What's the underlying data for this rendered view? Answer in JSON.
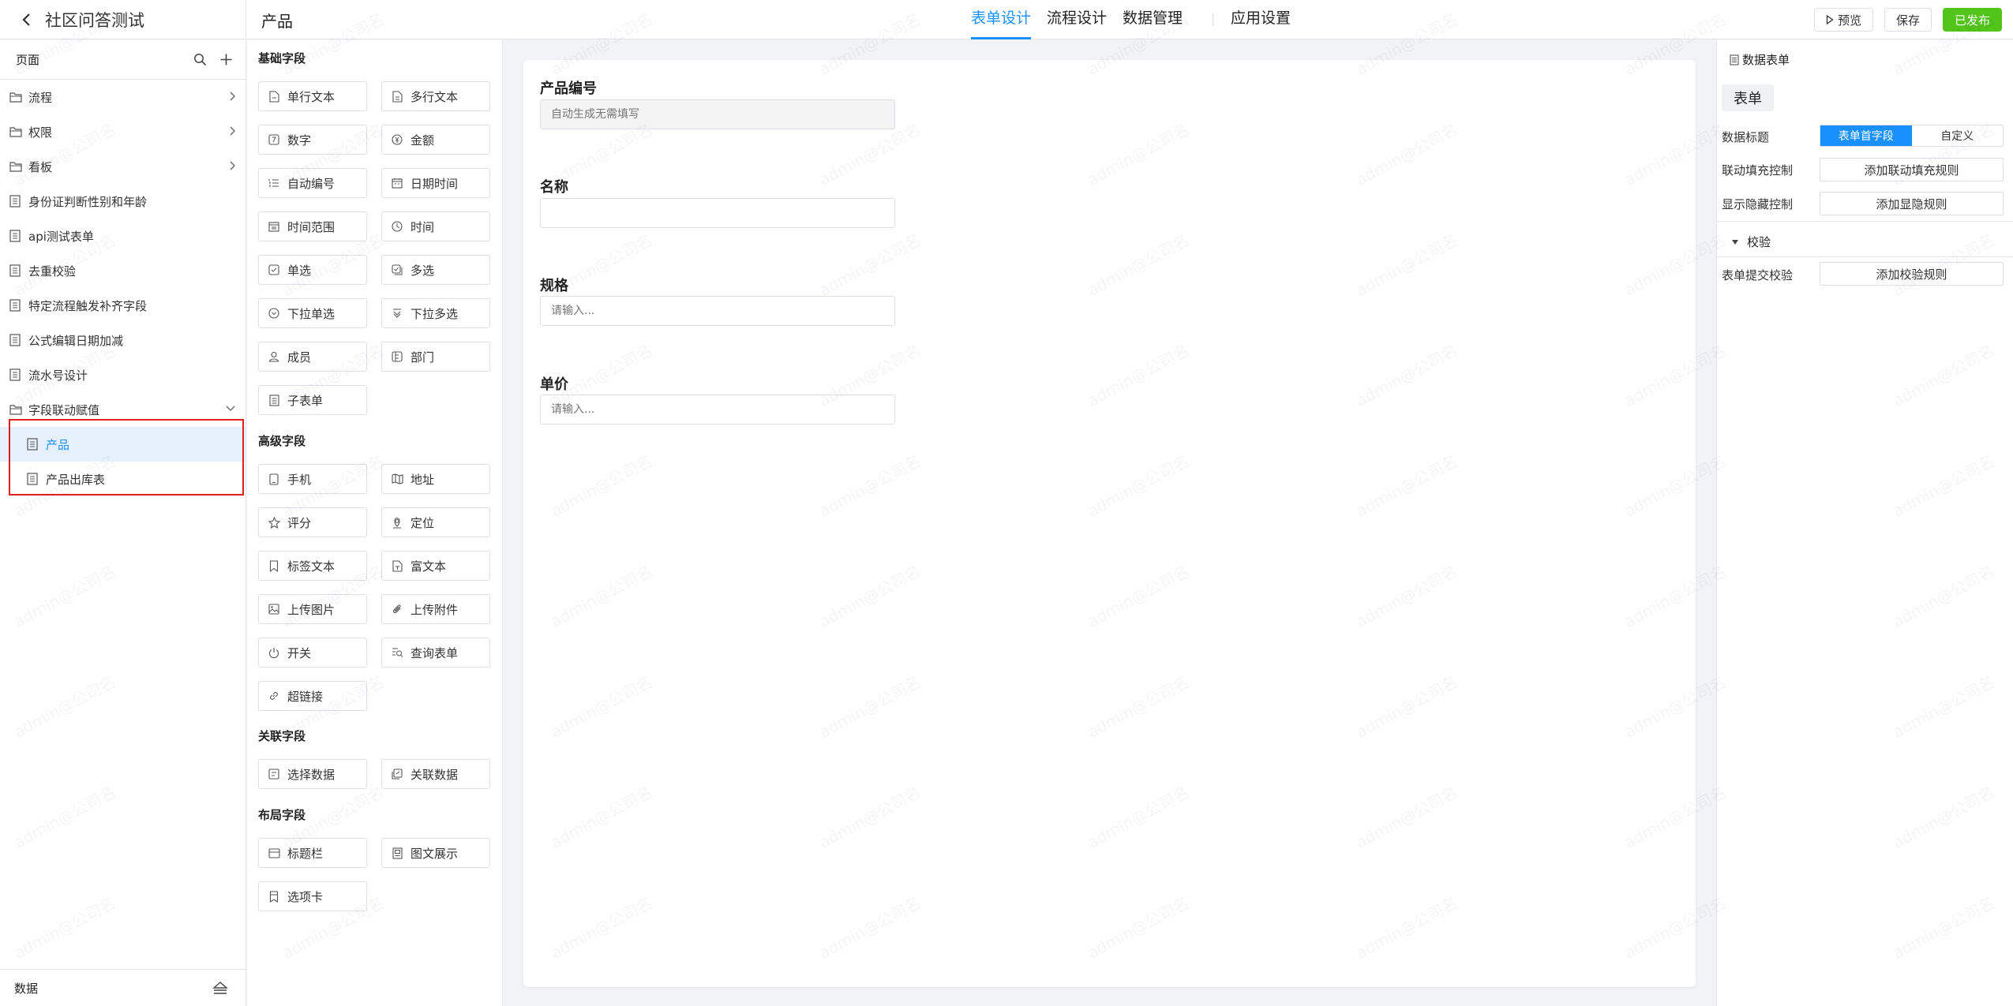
{
  "header": {
    "app_title": "社区问答测试",
    "page_title": "产品",
    "tabs": [
      {
        "label": "表单设计",
        "active": true
      },
      {
        "label": "流程设计",
        "active": false
      },
      {
        "label": "数据管理",
        "active": false
      },
      {
        "label": "应用设置",
        "active": false
      }
    ],
    "actions": {
      "preview": "预览",
      "save": "保存",
      "publish": "已发布"
    }
  },
  "sidebar": {
    "header_label": "页面",
    "items": [
      {
        "label": "流程",
        "type": "folder"
      },
      {
        "label": "权限",
        "type": "folder"
      },
      {
        "label": "看板",
        "type": "folder"
      },
      {
        "label": "身份证判断性别和年龄",
        "type": "form"
      },
      {
        "label": "api测试表单",
        "type": "form"
      },
      {
        "label": "去重校验",
        "type": "form"
      },
      {
        "label": "特定流程触发补齐字段",
        "type": "form"
      },
      {
        "label": "公式编辑日期加减",
        "type": "form"
      },
      {
        "label": "流水号设计",
        "type": "form"
      },
      {
        "label": "字段联动赋值",
        "type": "folder-open"
      },
      {
        "label": "产品",
        "type": "form",
        "selected": true
      },
      {
        "label": "产品出库表",
        "type": "form"
      }
    ],
    "footer_label": "数据"
  },
  "palette": {
    "sections": {
      "basic": "基础字段",
      "advanced": "高级字段",
      "relation": "关联字段",
      "layout": "布局字段"
    },
    "basic": [
      "单行文本",
      "多行文本",
      "数字",
      "金额",
      "自动编号",
      "日期时间",
      "时间范围",
      "时间",
      "单选",
      "多选",
      "下拉单选",
      "下拉多选",
      "成员",
      "部门",
      "子表单"
    ],
    "advanced": [
      "手机",
      "地址",
      "评分",
      "定位",
      "标签文本",
      "富文本",
      "上传图片",
      "上传附件",
      "开关",
      "查询表单",
      "超链接"
    ],
    "relation": [
      "选择数据",
      "关联数据"
    ],
    "layout": [
      "标题栏",
      "图文展示",
      "选项卡"
    ]
  },
  "form": {
    "fields": [
      {
        "label": "产品编号",
        "placeholder": "自动生成无需填写",
        "disabled": true
      },
      {
        "label": "名称",
        "placeholder": "",
        "disabled": false
      },
      {
        "label": "规格",
        "placeholder": "请输入...",
        "disabled": false
      },
      {
        "label": "单价",
        "placeholder": "请输入...",
        "disabled": false
      }
    ]
  },
  "properties": {
    "header": "数据表单",
    "tab": "表单",
    "data_title_label": "数据标题",
    "data_title_options": [
      "表单首字段",
      "自定义"
    ],
    "linkage_label": "联动填充控制",
    "linkage_button": "添加联动填充规则",
    "visibility_label": "显示隐藏控制",
    "visibility_button": "添加显隐规则",
    "validation_section": "校验",
    "submit_validation_label": "表单提交校验",
    "submit_validation_button": "添加校验规则"
  },
  "watermark": "admin@公司名",
  "colors": {
    "accent": "#1890ff",
    "publish": "#52c41a",
    "highlight_border": "#e02020"
  }
}
